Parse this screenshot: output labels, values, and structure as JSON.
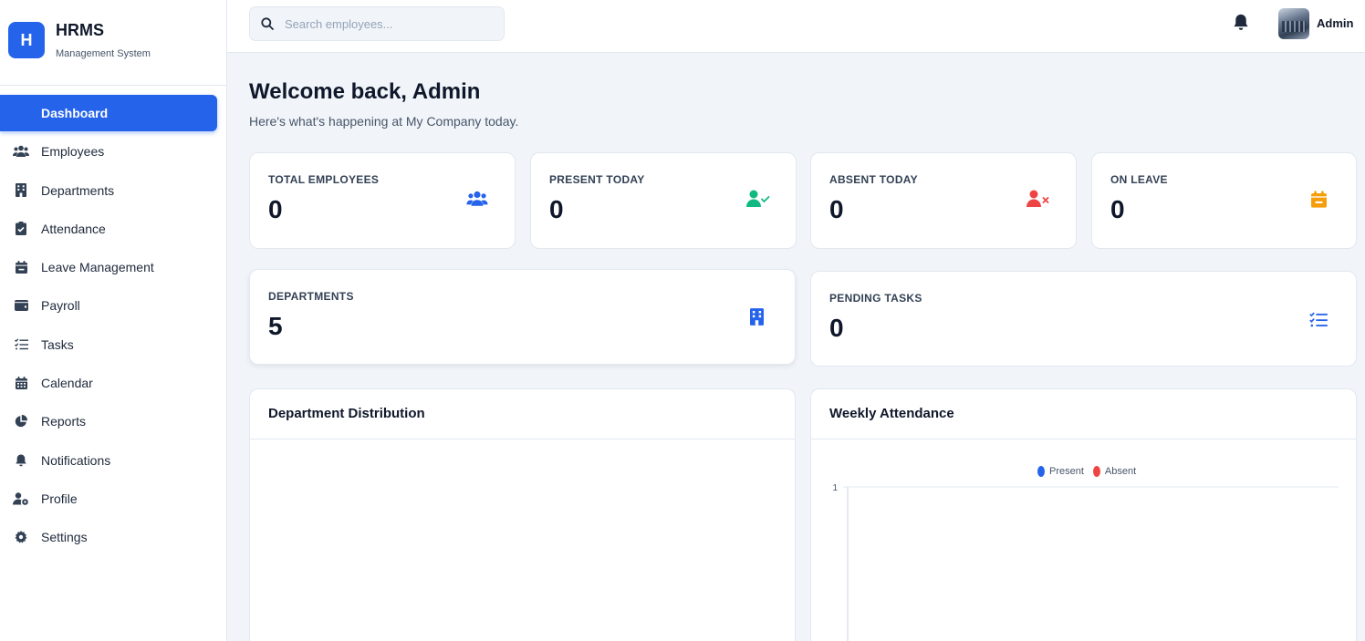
{
  "brand": {
    "logo_letter": "H",
    "title": "HRMS",
    "subtitle": "Management System"
  },
  "sidebar": {
    "items": [
      {
        "label": "Dashboard",
        "icon": "dashboard-icon",
        "active": true
      },
      {
        "label": "Employees",
        "icon": "users-icon"
      },
      {
        "label": "Departments",
        "icon": "building-icon"
      },
      {
        "label": "Attendance",
        "icon": "clipboard-check-icon"
      },
      {
        "label": "Leave Management",
        "icon": "calendar-minus-icon"
      },
      {
        "label": "Payroll",
        "icon": "wallet-icon"
      },
      {
        "label": "Tasks",
        "icon": "list-check-icon"
      },
      {
        "label": "Calendar",
        "icon": "calendar-icon"
      },
      {
        "label": "Reports",
        "icon": "pie-chart-icon"
      },
      {
        "label": "Notifications",
        "icon": "bell-icon"
      },
      {
        "label": "Profile",
        "icon": "user-gear-icon"
      },
      {
        "label": "Settings",
        "icon": "gear-icon"
      }
    ]
  },
  "topbar": {
    "search_placeholder": "Search employees...",
    "user_name": "Admin"
  },
  "main": {
    "welcome_title": "Welcome back, Admin",
    "welcome_subtitle": "Here's what's happening at My Company today."
  },
  "stats": [
    {
      "label": "TOTAL EMPLOYEES",
      "value": "0",
      "icon": "users-icon",
      "color": "#2563eb"
    },
    {
      "label": "PRESENT TODAY",
      "value": "0",
      "icon": "user-check-icon",
      "color": "#10b981"
    },
    {
      "label": "ABSENT TODAY",
      "value": "0",
      "icon": "user-x-icon",
      "color": "#ef4444"
    },
    {
      "label": "ON LEAVE",
      "value": "0",
      "icon": "calendar-minus-icon",
      "color": "#f59e0b"
    },
    {
      "label": "DEPARTMENTS",
      "value": "5",
      "icon": "building-icon",
      "color": "#2563eb"
    },
    {
      "label": "PENDING TASKS",
      "value": "0",
      "icon": "list-check-icon",
      "color": "#2563eb"
    }
  ],
  "panels": {
    "department_distribution": {
      "title": "Department Distribution"
    },
    "weekly_attendance": {
      "title": "Weekly Attendance"
    }
  },
  "chart_data": {
    "type": "bar",
    "title": "Weekly Attendance",
    "series": [
      {
        "name": "Present",
        "color": "#2563eb",
        "values": []
      },
      {
        "name": "Absent",
        "color": "#ef4444",
        "values": []
      }
    ],
    "y_tick_labels": [
      "1"
    ],
    "legend": "top-center",
    "grid": true
  },
  "colors": {
    "accent": "#2563eb",
    "success": "#10b981",
    "danger": "#ef4444",
    "warning": "#f59e0b"
  }
}
